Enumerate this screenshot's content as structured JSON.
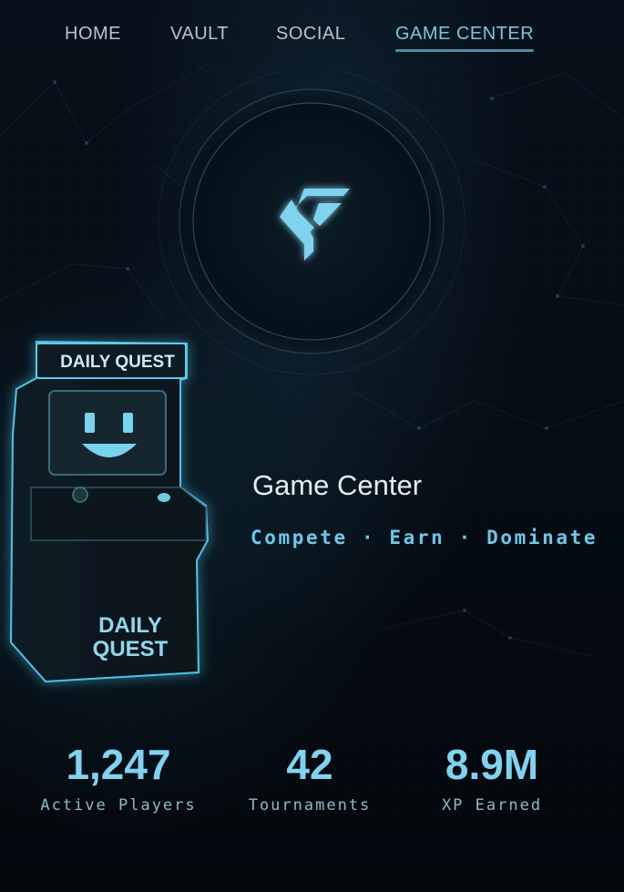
{
  "nav": {
    "items": [
      {
        "label": "HOME",
        "active": false
      },
      {
        "label": "VAULT",
        "active": false
      },
      {
        "label": "SOCIAL",
        "active": false
      },
      {
        "label": "GAME CENTER",
        "active": true
      }
    ]
  },
  "logo": {
    "icon": "game-center-logo-icon"
  },
  "arcade": {
    "marquee": "DAILY QUEST",
    "panel_line1": "DAILY",
    "panel_line2": "QUEST",
    "icon": "arcade-cabinet-icon"
  },
  "hero": {
    "title": "Game Center",
    "tagline": "Compete · Earn · Dominate"
  },
  "stats": [
    {
      "value": "1,247",
      "label": "Active Players"
    },
    {
      "value": "42",
      "label": "Tournaments"
    },
    {
      "value": "8.9M",
      "label": "XP Earned"
    }
  ],
  "colors": {
    "background": "#050b12",
    "accent": "#7cc6dd",
    "accent_glow": "#5fd0f0",
    "text": "#e6ecef"
  }
}
